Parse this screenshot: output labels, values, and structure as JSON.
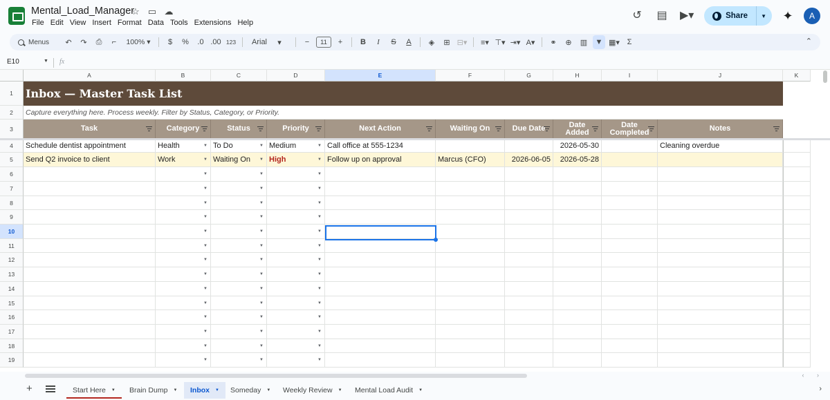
{
  "app": {
    "doc_title": "Mental_Load_Manager",
    "menus": [
      "File",
      "Edit",
      "View",
      "Insert",
      "Format",
      "Data",
      "Tools",
      "Extensions",
      "Help"
    ],
    "share_label": "Share",
    "avatar_initial": "A"
  },
  "toolbar": {
    "search_label": "Menus",
    "zoom": "100%",
    "currency": "$",
    "percent": "%",
    "decrease_decimal": ".0",
    "increase_decimal": ".00",
    "number_format": "123",
    "font": "Arial",
    "font_size": "11"
  },
  "formula_bar": {
    "name_box": "E10",
    "fx": "fx",
    "value": ""
  },
  "sheet": {
    "columns": [
      "A",
      "B",
      "C",
      "D",
      "E",
      "F",
      "G",
      "H",
      "I",
      "J",
      "K"
    ],
    "selected_column": "E",
    "selected_row": 10,
    "title": "Inbox — Master Task List",
    "subtitle": "Capture everything here. Process weekly. Filter by Status, Category, or Priority.",
    "headers": [
      "Task",
      "Category",
      "Status",
      "Priority",
      "Next Action",
      "Waiting On",
      "Due Date",
      "Date Added",
      "Date Completed",
      "Notes"
    ],
    "rows": [
      {
        "task": "Schedule dentist appointment",
        "category": "Health",
        "status": "To Do",
        "priority": "Medium",
        "next_action": "Call office at 555-1234",
        "waiting_on": "",
        "due_date": "",
        "date_added": "2026-05-30",
        "date_completed": "",
        "notes": "Cleaning overdue"
      },
      {
        "task": "Send Q2 invoice to client",
        "category": "Work",
        "status": "Waiting On",
        "priority": "High",
        "next_action": "Follow up on approval",
        "waiting_on": "Marcus (CFO)",
        "due_date": "2026-06-05",
        "date_added": "2026-05-28",
        "date_completed": "",
        "notes": ""
      }
    ],
    "row_numbers": [
      "1",
      "2",
      "3",
      "4",
      "5",
      "6",
      "7",
      "8",
      "9",
      "10",
      "11",
      "12",
      "13",
      "14",
      "15",
      "16",
      "17",
      "18",
      "19"
    ]
  },
  "tabs": [
    {
      "label": "Start Here",
      "active": false
    },
    {
      "label": "Brain Dump",
      "active": false
    },
    {
      "label": "Inbox",
      "active": true
    },
    {
      "label": "Someday",
      "active": false
    },
    {
      "label": "Weekly Review",
      "active": false
    },
    {
      "label": "Mental Load Audit",
      "active": false
    }
  ],
  "colors": {
    "title_bg": "#5e4a3a",
    "header_bg": "#a59788",
    "highlight_row": "#fef7d8",
    "priority_high": "#b3261e",
    "selection": "#1a73e8"
  }
}
